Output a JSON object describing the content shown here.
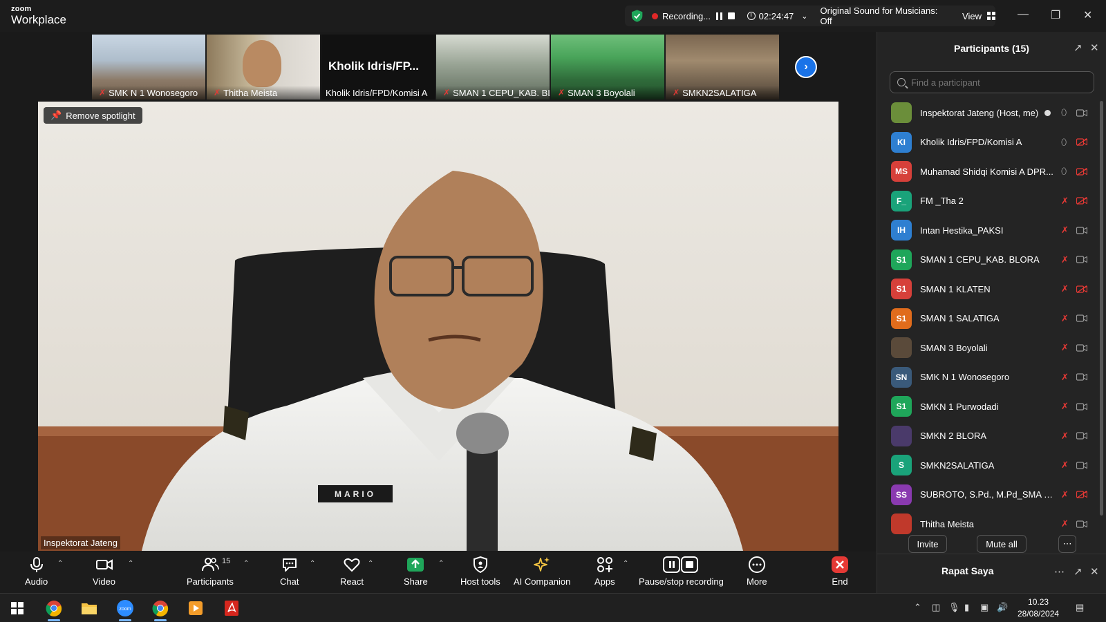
{
  "app": {
    "logo_small": "zoom",
    "logo_big": "Workplace"
  },
  "topbar": {
    "recording_label": "Recording...",
    "timer": "02:24:47",
    "original_sound": "Original Sound for Musicians: Off",
    "view_label": "View"
  },
  "thumbnails": [
    {
      "label": "SMK N 1 Wonosegoro"
    },
    {
      "label": "Thitha Meista"
    },
    {
      "label": "Kholik Idris/FPD/Komisi A",
      "big_name": "Kholik  Idris/FP..."
    },
    {
      "label": "SMAN 1 CEPU_KAB. BL..."
    },
    {
      "label": "SMAN 3 Boyolali"
    },
    {
      "label": "SMKN2SALATIGA"
    }
  ],
  "main": {
    "spotlight_label": "Remove spotlight",
    "speaker_name": "Inspektorat Jateng",
    "badge_text": "MARIO"
  },
  "toolbar": {
    "audio": "Audio",
    "video": "Video",
    "participants": "Participants",
    "participants_count": "15",
    "chat": "Chat",
    "react": "React",
    "share": "Share",
    "host_tools": "Host tools",
    "ai_companion": "AI Companion",
    "apps": "Apps",
    "pause_recording": "Pause/stop recording",
    "more": "More",
    "end": "End"
  },
  "sidebar": {
    "title": "Participants (15)",
    "search_placeholder": "Find a participant",
    "invite": "Invite",
    "mute_all": "Mute all",
    "footer_title": "Rapat Saya",
    "participants": [
      {
        "initials": "",
        "name": "Inspektorat Jateng (Host, me)",
        "color": "#6b8e3a",
        "mic": "on",
        "cam": "on",
        "rec": true
      },
      {
        "initials": "KI",
        "name": "Kholik Idris/FPD/Komisi A",
        "color": "#2e7fd1",
        "mic": "on",
        "cam": "off"
      },
      {
        "initials": "MS",
        "name": "Muhamad Shidqi Komisi A DPR...",
        "color": "#d6403a",
        "mic": "on",
        "cam": "off"
      },
      {
        "initials": "F_",
        "name": "FM _Tha 2",
        "color": "#1aa37a",
        "mic": "off",
        "cam": "off"
      },
      {
        "initials": "IH",
        "name": "Intan Hestika_PAKSI",
        "color": "#2e7fd1",
        "mic": "off",
        "cam": "on"
      },
      {
        "initials": "S1",
        "name": "SMAN 1 CEPU_KAB. BLORA",
        "color": "#1fa65a",
        "mic": "off",
        "cam": "on"
      },
      {
        "initials": "S1",
        "name": "SMAN 1 KLATEN",
        "color": "#d6403a",
        "mic": "off",
        "cam": "off"
      },
      {
        "initials": "S1",
        "name": "SMAN 1 SALATIGA",
        "color": "#e06c1c",
        "mic": "off",
        "cam": "on"
      },
      {
        "initials": "",
        "name": "SMAN 3 Boyolali",
        "color": "#5a4a3a",
        "mic": "off",
        "cam": "on"
      },
      {
        "initials": "SN",
        "name": "SMK N 1 Wonosegoro",
        "color": "#3a5a7a",
        "mic": "off",
        "cam": "on"
      },
      {
        "initials": "S1",
        "name": "SMKN 1 Purwodadi",
        "color": "#1fa65a",
        "mic": "off",
        "cam": "on"
      },
      {
        "initials": "",
        "name": "SMKN 2 BLORA",
        "color": "#4a3a6a",
        "mic": "off",
        "cam": "on"
      },
      {
        "initials": "S",
        "name": "SMKN2SALATIGA",
        "color": "#1aa37a",
        "mic": "off",
        "cam": "on"
      },
      {
        "initials": "SS",
        "name": "SUBROTO, S.Pd., M.Pd_SMA 1 SA...",
        "color": "#8a3ab0",
        "mic": "off",
        "cam": "off"
      },
      {
        "initials": "",
        "name": "Thitha Meista",
        "color": "#c0392b",
        "mic": "off",
        "cam": "on"
      }
    ]
  },
  "taskbar": {
    "time": "10.23",
    "date": "28/08/2024"
  },
  "colors": {
    "accent_blue": "#1a73e8",
    "recording_red": "#e02828",
    "share_green": "#1fa65a",
    "end_red": "#e53935",
    "mic_off_red": "#e53935"
  }
}
